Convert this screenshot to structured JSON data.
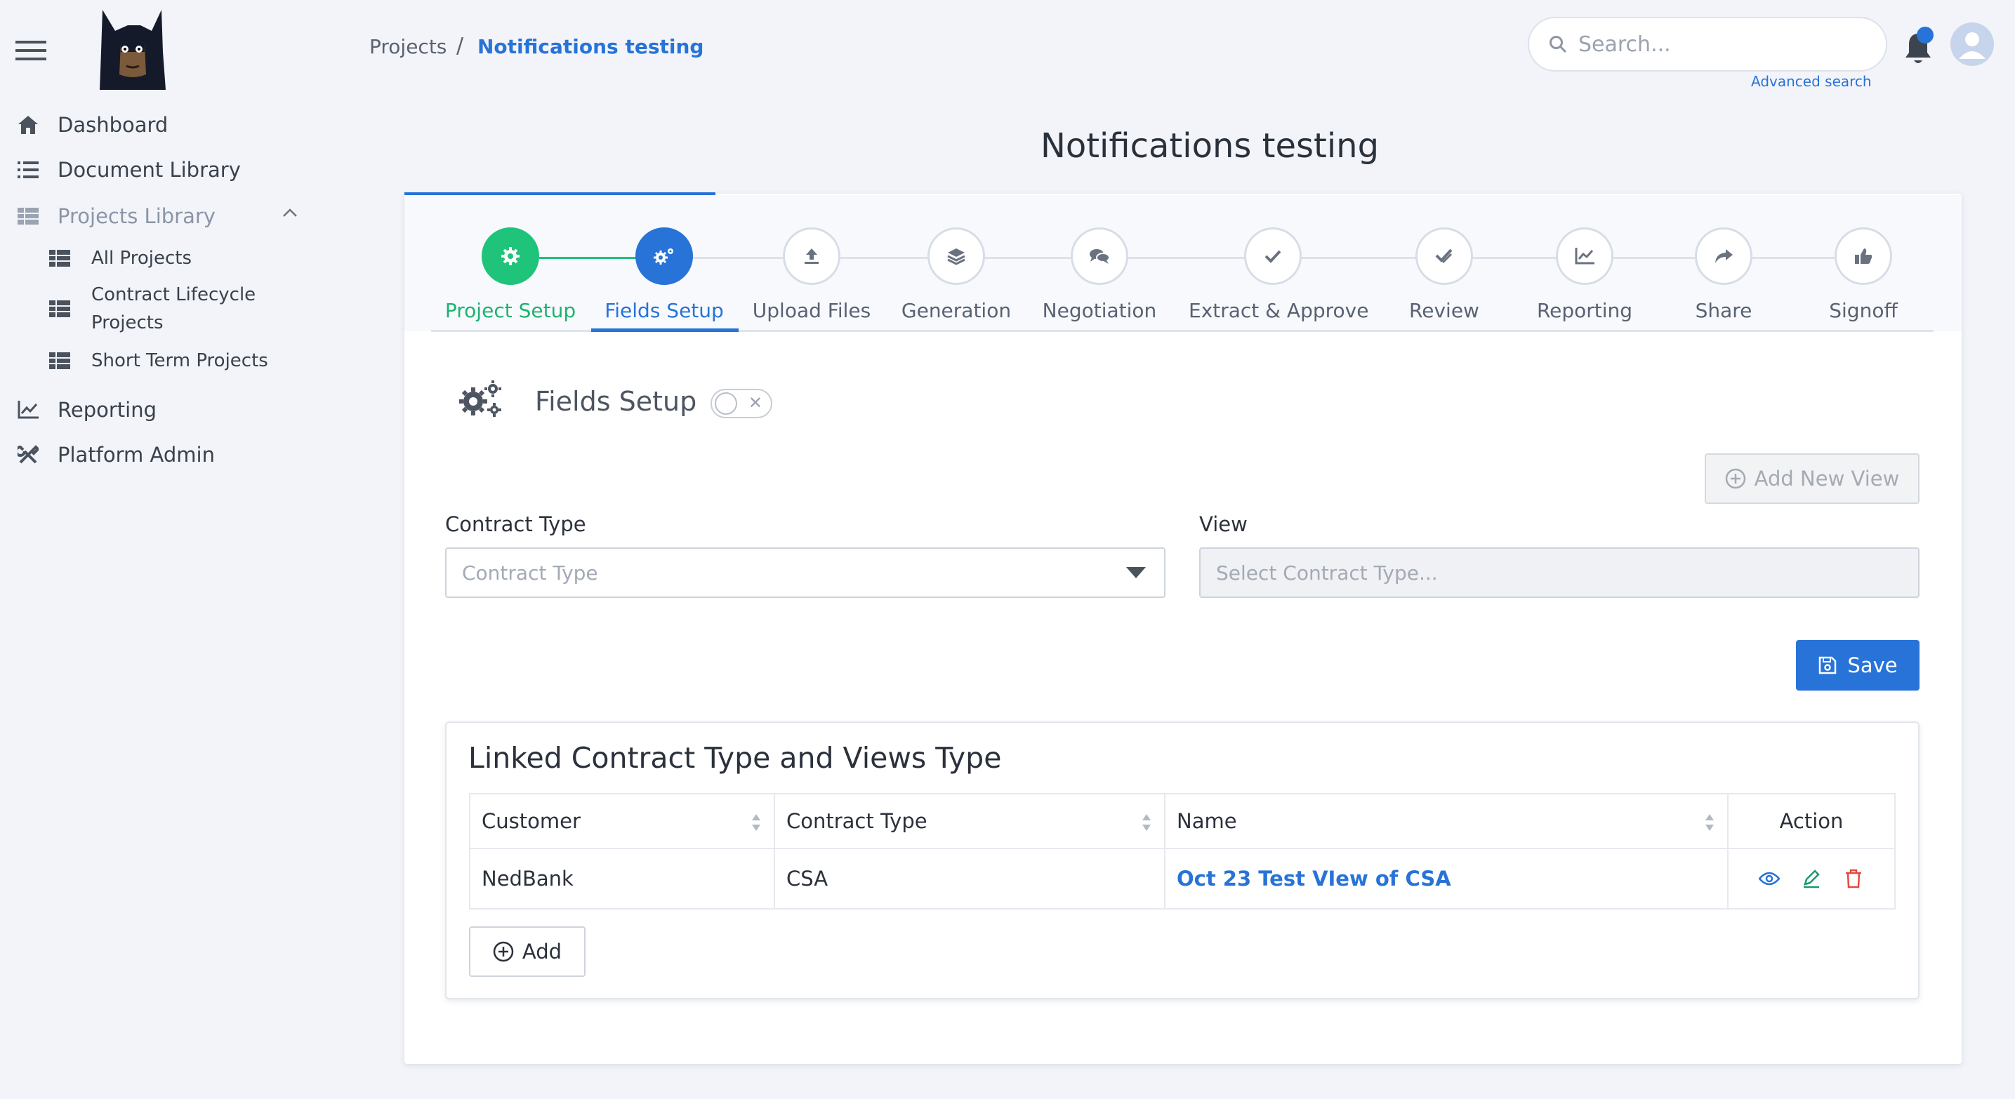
{
  "header": {
    "breadcrumb_root": "Projects",
    "breadcrumb_separator": "/",
    "breadcrumb_current": "Notifications testing",
    "search_placeholder": "Search...",
    "advanced_search": "Advanced search",
    "notification_dot": true
  },
  "sidebar": {
    "items": [
      {
        "label": "Dashboard",
        "icon": "home-icon"
      },
      {
        "label": "Document Library",
        "icon": "list-icon"
      },
      {
        "label": "Projects Library",
        "icon": "table-icon",
        "expanded": true
      },
      {
        "label": "Reporting",
        "icon": "chart-icon"
      },
      {
        "label": "Platform Admin",
        "icon": "tools-icon"
      }
    ],
    "sub_items": [
      {
        "label": "All Projects"
      },
      {
        "label": "Contract Lifecycle Projects"
      },
      {
        "label": "Short Term Projects"
      }
    ]
  },
  "page": {
    "title": "Notifications testing"
  },
  "stepper": {
    "steps": [
      {
        "label": "Project Setup",
        "state": "done"
      },
      {
        "label": "Fields Setup",
        "state": "active"
      },
      {
        "label": "Upload Files",
        "state": "pending"
      },
      {
        "label": "Generation",
        "state": "pending"
      },
      {
        "label": "Negotiation",
        "state": "pending"
      },
      {
        "label": "Extract & Approve",
        "state": "pending"
      },
      {
        "label": "Review",
        "state": "pending"
      },
      {
        "label": "Reporting",
        "state": "pending"
      },
      {
        "label": "Share",
        "state": "pending"
      },
      {
        "label": "Signoff",
        "state": "pending"
      }
    ]
  },
  "fields_setup": {
    "title": "Fields Setup",
    "toggle_on": false,
    "add_view_label": "Add New View",
    "contract_type_label": "Contract Type",
    "contract_type_placeholder": "Contract Type",
    "view_label": "View",
    "view_placeholder": "Select Contract Type...",
    "save_label": "Save"
  },
  "linked": {
    "title": "Linked Contract Type and Views Type",
    "columns": [
      "Customer",
      "Contract Type",
      "Name",
      "Action"
    ],
    "rows": [
      {
        "customer": "NedBank",
        "contract_type": "CSA",
        "name": "Oct 23 Test VIew of CSA"
      }
    ],
    "add_label": "Add"
  },
  "colors": {
    "accent": "#2773d8",
    "success": "#1fc37a",
    "danger": "#e5483f",
    "background": "#f2f4f9"
  }
}
